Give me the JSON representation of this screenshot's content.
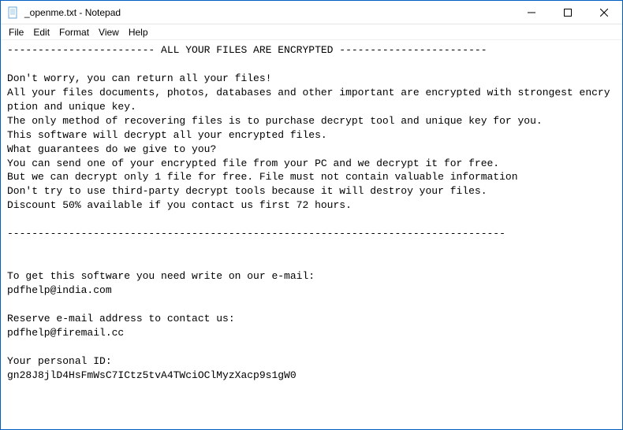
{
  "window": {
    "title": "_openme.txt - Notepad"
  },
  "menu": {
    "file": "File",
    "edit": "Edit",
    "format": "Format",
    "view": "View",
    "help": "Help"
  },
  "content": {
    "text": "------------------------ ALL YOUR FILES ARE ENCRYPTED ------------------------\n\nDon't worry, you can return all your files!\nAll your files documents, photos, databases and other important are encrypted with strongest encryption and unique key.\nThe only method of recovering files is to purchase decrypt tool and unique key for you.\nThis software will decrypt all your encrypted files.\nWhat guarantees do we give to you?\nYou can send one of your encrypted file from your PC and we decrypt it for free.\nBut we can decrypt only 1 file for free. File must not contain valuable information\nDon't try to use third-party decrypt tools because it will destroy your files.\nDiscount 50% available if you contact us first 72 hours.\n\n---------------------------------------------------------------------------------\n\n\nTo get this software you need write on our e-mail:\npdfhelp@india.com\n\nReserve e-mail address to contact us:\npdfhelp@firemail.cc\n\nYour personal ID:\ngn28J8jlD4HsFmWsC7ICtz5tvA4TWciOClMyzXacp9s1gW0"
  }
}
